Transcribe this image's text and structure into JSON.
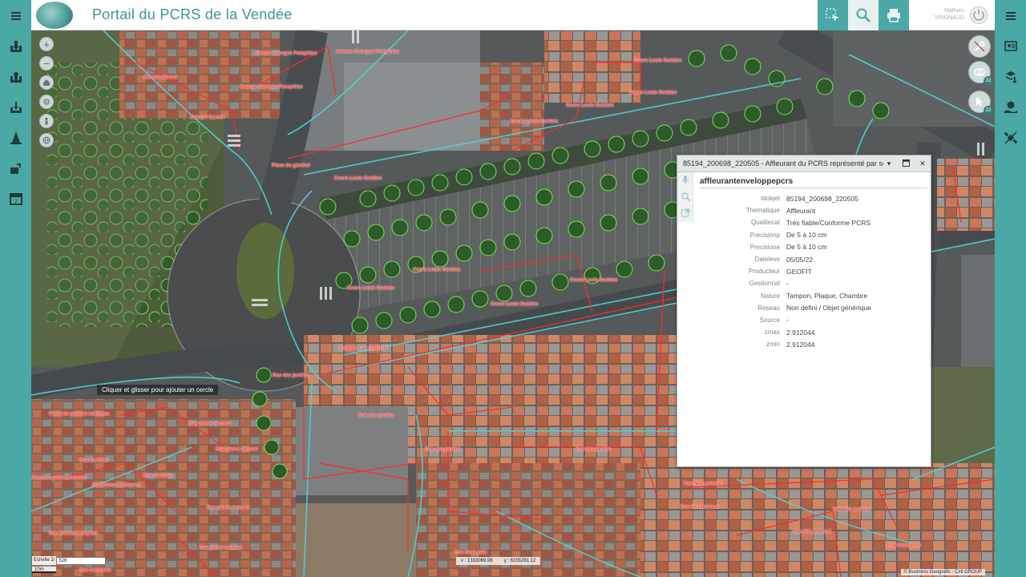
{
  "app": {
    "title": "Portail du PCRS de la Vendée",
    "user_first": "Mathieu",
    "user_last": "VRIGNAUD"
  },
  "colors": {
    "teal": "#4aa8a6",
    "parcel_red": "#ff2a2a",
    "network_cyan": "#4fd0d3",
    "tree_green": "#6fdc55"
  },
  "left_toolbar": [
    {
      "icon": "menu-icon"
    },
    {
      "icon": "import-layer-icon"
    },
    {
      "icon": "export-layer-icon"
    },
    {
      "icon": "download-layer-icon"
    },
    {
      "icon": "cone-icon"
    },
    {
      "icon": "layers-edit-icon"
    },
    {
      "icon": "calendar-icon"
    }
  ],
  "right_toolbar": [
    {
      "icon": "menu-icon"
    },
    {
      "icon": "dashboard-icon"
    },
    {
      "icon": "layers-download-icon"
    },
    {
      "icon": "globe-hand-icon"
    },
    {
      "icon": "satellite-off-icon"
    }
  ],
  "header_tools": [
    {
      "icon": "select-tool-icon"
    },
    {
      "icon": "zoom-search-icon"
    },
    {
      "icon": "print-icon"
    }
  ],
  "map_tools": {
    "measure_count": "22",
    "select_count": "22"
  },
  "map": {
    "tooltip": "Cliquer et glisser pour ajouter un cercle",
    "scale_label": "Echelle 1/",
    "scale_value": "528",
    "scale_bar": "10m",
    "coord_x": "x : 1333069.96",
    "coord_y": "y : 6155281.12",
    "copyright": "© Business Geografic - Ciril GROUP"
  },
  "panel": {
    "title": "85194_200698_220505 - Affleurant du PCRS représenté par so...",
    "layer": "affleurantenveloppepcrs",
    "attributes": [
      {
        "key": "Idobjet",
        "value": "85194_200698_220505"
      },
      {
        "key": "Thematique",
        "value": "Affleurant"
      },
      {
        "key": "Qualitecat",
        "value": "Très fiable/Conforme PCRS"
      },
      {
        "key": "Precisionp",
        "value": "De 5 à 10 cm"
      },
      {
        "key": "Precisiona",
        "value": "De 5 à 10 cm"
      },
      {
        "key": "Dateleve",
        "value": "05/05/22"
      },
      {
        "key": "Producteur",
        "value": "GEOFIT"
      },
      {
        "key": "Gestionnal",
        "value": "-"
      },
      {
        "key": "Nature",
        "value": "Tampon, Plaque, Chambre"
      },
      {
        "key": "Reseau",
        "value": "Non défini / Objet générique"
      },
      {
        "key": "Source",
        "value": "-"
      },
      {
        "key": "zmax",
        "value": "2.912044"
      },
      {
        "key": "zmin",
        "value": "2.912044"
      }
    ]
  },
  "map_labels": [
    {
      "text": "Avenue Georges Pompidou"
    },
    {
      "text": "Avenue Georges Pompidou"
    },
    {
      "text": "Avenue Georges Pompidou"
    },
    {
      "text": "Avenue Carnot"
    },
    {
      "text": "Avenue Carnot"
    },
    {
      "text": "Cours Louis Guédon"
    },
    {
      "text": "Cours Louis Guédon"
    },
    {
      "text": "Cours Louis Guédon"
    },
    {
      "text": "Cours Louis Guédon"
    },
    {
      "text": "Cours Louis Guédon"
    },
    {
      "text": "Cours Louis Guédon"
    },
    {
      "text": "Cours Louis Guédon"
    },
    {
      "text": "Cours Louis Guédon"
    },
    {
      "text": "Cours Louis Guédon"
    },
    {
      "text": "Cours Louis Guédon"
    },
    {
      "text": "Place du général"
    },
    {
      "text": "Place du général collineau"
    },
    {
      "text": "Rue des jardins"
    },
    {
      "text": "Rue des jardins"
    },
    {
      "text": "Rue des jardins"
    },
    {
      "text": "Rue des jardins"
    },
    {
      "text": "Rue pierre semard"
    },
    {
      "text": "Rue pierre semard"
    },
    {
      "text": "Rue pierre semard"
    },
    {
      "text": "Rue pierre semard"
    },
    {
      "text": "Rue du bidet"
    },
    {
      "text": "Rue du bidet"
    },
    {
      "text": "Rue Edouard Mayeux"
    },
    {
      "text": "Rue Edouard Mayeux"
    },
    {
      "text": "Place du poilu de france"
    },
    {
      "text": "Rue de la paix"
    },
    {
      "text": "Rue Nils poiraud"
    },
    {
      "text": "Rue Nils poiraud"
    },
    {
      "text": "Rue Nils poiraud"
    },
    {
      "text": "Rue Nils poiraud"
    },
    {
      "text": "Rue bourgeois"
    },
    {
      "text": "Rue nationale"
    }
  ]
}
